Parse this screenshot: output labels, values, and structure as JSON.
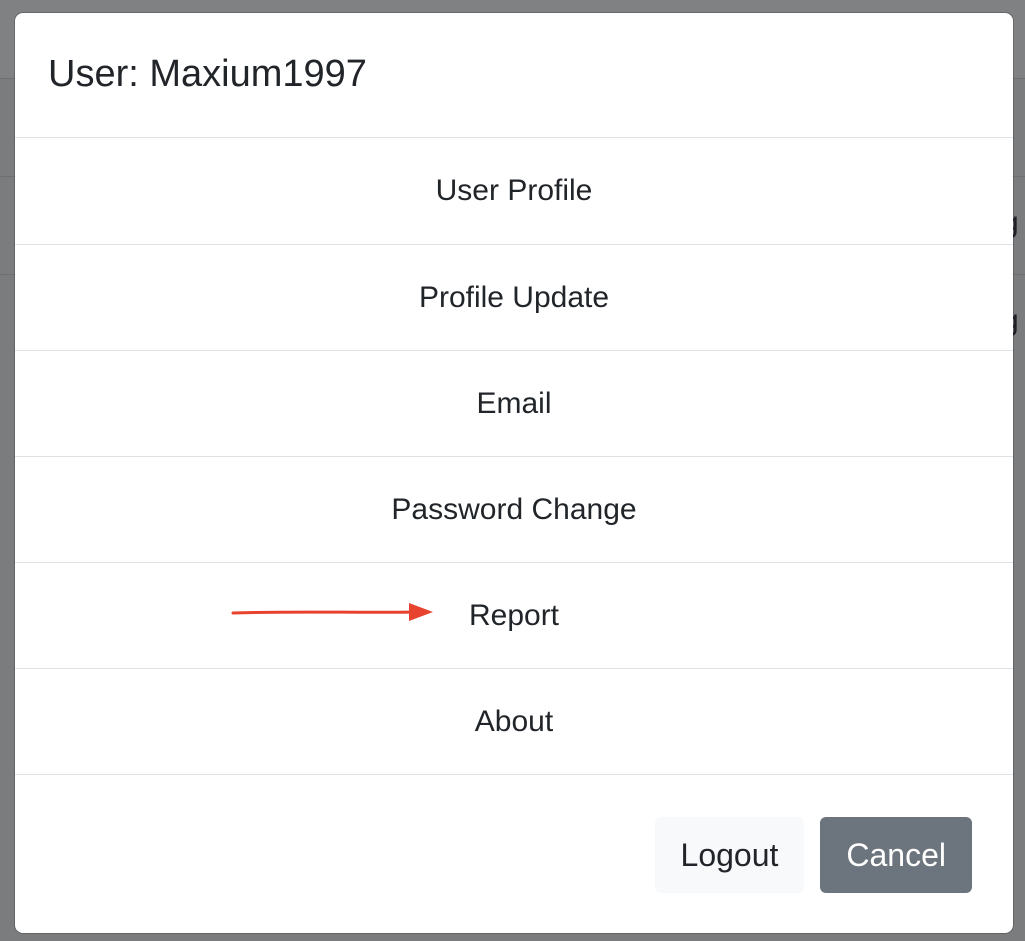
{
  "dialog": {
    "title": "User: Maxium1997"
  },
  "menu": {
    "items": [
      {
        "label": "User Profile"
      },
      {
        "label": "Profile Update"
      },
      {
        "label": "Email"
      },
      {
        "label": "Password Change"
      },
      {
        "label": "Report"
      },
      {
        "label": "About"
      }
    ]
  },
  "footer": {
    "logout_label": "Logout",
    "cancel_label": "Cancel"
  },
  "annotation": {
    "arrow_color": "#e8432e",
    "points_to": "Report"
  },
  "colors": {
    "overlay": "#7b7c7e",
    "divider": "#dee2e6",
    "text": "#212529",
    "secondary_button": "#6c757d",
    "light_button": "#f8f9fa"
  },
  "background": {
    "fragments": [
      "g",
      "g"
    ]
  }
}
